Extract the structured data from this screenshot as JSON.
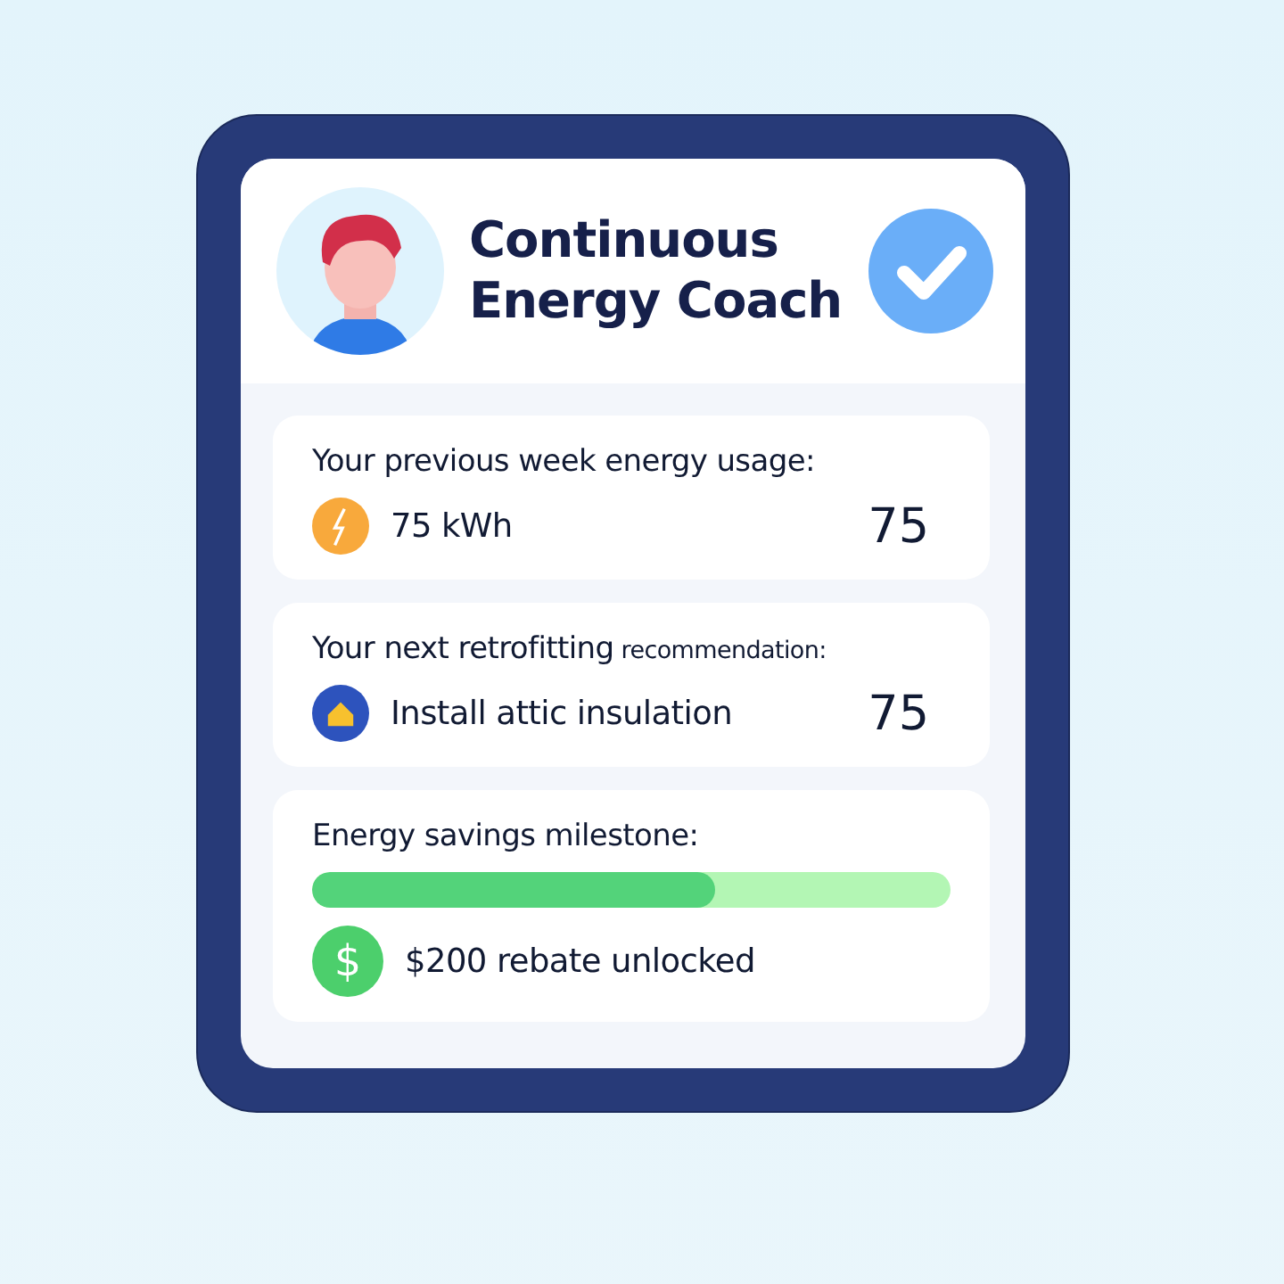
{
  "header": {
    "title_lines": [
      "Continuous",
      "Energy Coach"
    ],
    "verified": true
  },
  "cards": [
    {
      "kind": "usage",
      "title": "Your previous week energy usage:",
      "text": "75 kWh",
      "value": "75"
    },
    {
      "kind": "recommendation",
      "title": "Your next retrofitting",
      "title_small": "recommendation:",
      "text": "Install attic insulation",
      "value": "75"
    },
    {
      "kind": "milestone",
      "title": "Energy savings milestone:",
      "level": 0.63,
      "icon_glyph": "$",
      "text": "$200 rebate unlocked"
    }
  ]
}
